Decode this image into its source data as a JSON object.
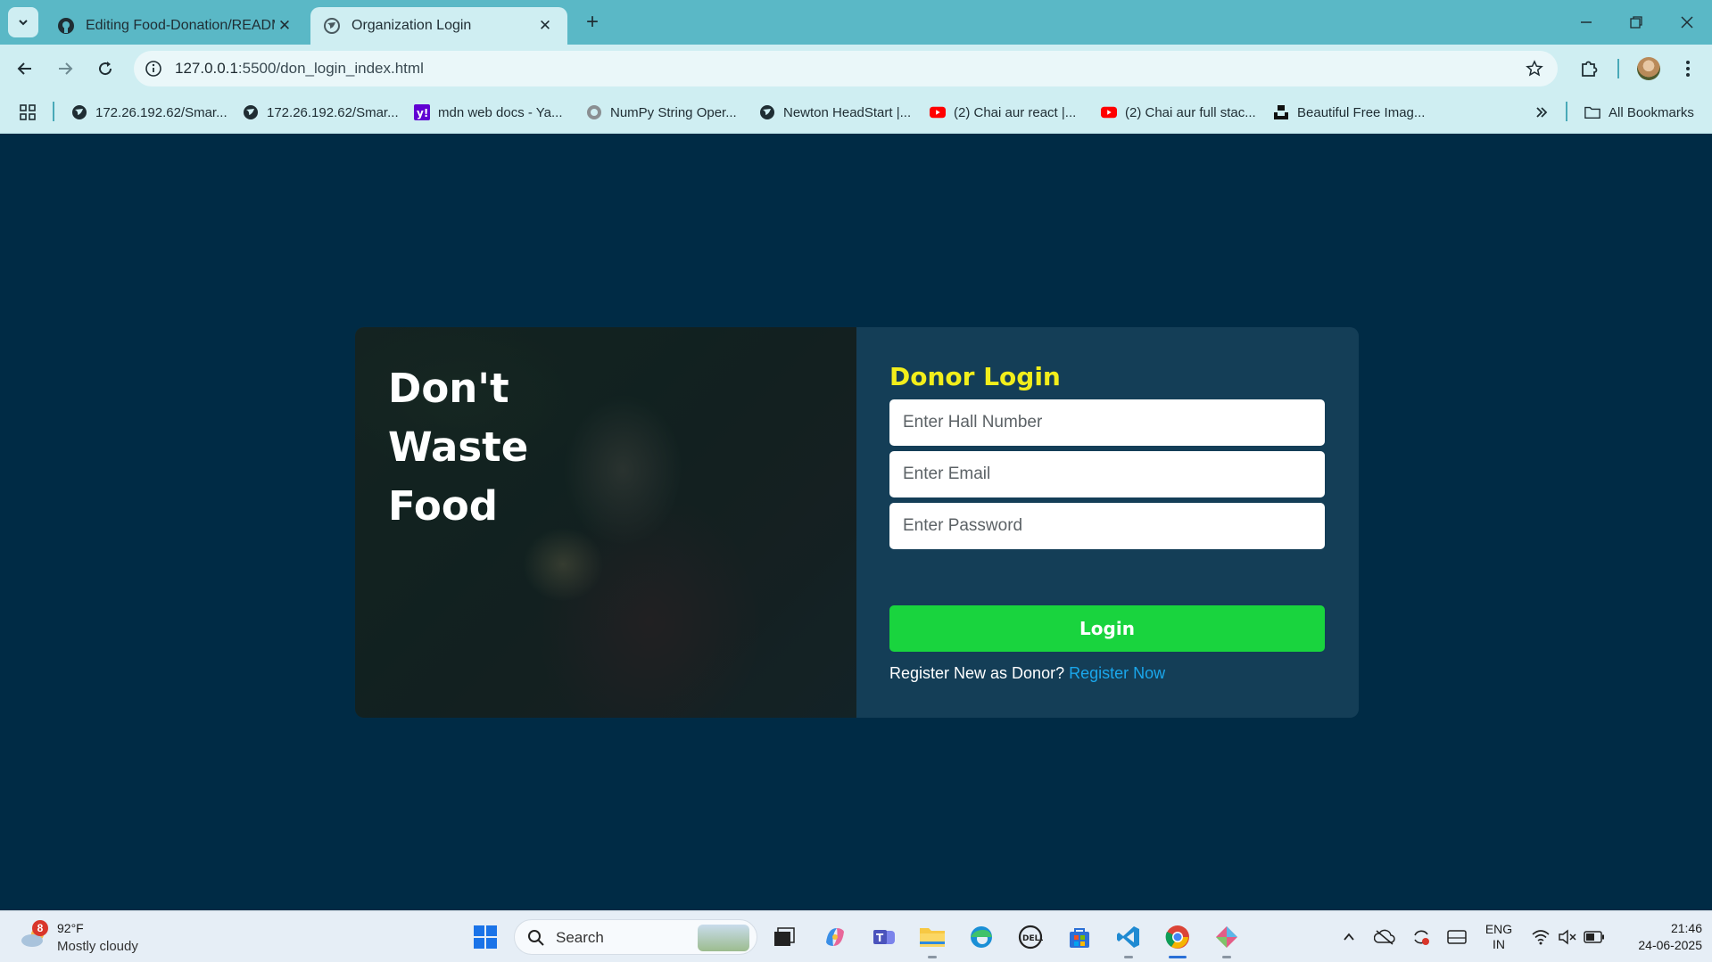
{
  "browser": {
    "tabs": [
      {
        "title": "Editing Food-Donation/README.md",
        "favicon": "github-icon",
        "active": false
      },
      {
        "title": "Organization Login",
        "favicon": "globe-icon",
        "active": true
      }
    ],
    "url_host": "127.0.0.1",
    "url_path": ":5500/don_login_index.html",
    "bookmarks": [
      {
        "label": "172.26.192.62/Smar...",
        "icon": "globe-icon"
      },
      {
        "label": "172.26.192.62/Smar...",
        "icon": "globe-icon"
      },
      {
        "label": "mdn web docs - Ya...",
        "icon": "yahoo-icon"
      },
      {
        "label": "NumPy String Oper...",
        "icon": "tf-icon"
      },
      {
        "label": "Newton HeadStart |...",
        "icon": "globe-icon"
      },
      {
        "label": "(2) Chai aur react |...",
        "icon": "youtube-icon"
      },
      {
        "label": "(2) Chai aur full stac...",
        "icon": "youtube-icon"
      },
      {
        "label": "Beautiful Free Imag...",
        "icon": "unsplash-icon"
      }
    ],
    "all_bookmarks_label": "All Bookmarks"
  },
  "page": {
    "slogan": [
      "Don't",
      "Waste",
      "Food"
    ],
    "form_title": "Donor Login",
    "fields": {
      "hall_placeholder": "Enter Hall Number",
      "email_placeholder": "Enter Email",
      "password_placeholder": "Enter Password"
    },
    "login_label": "Login",
    "register_text": "Register New as Donor?",
    "register_link": "Register Now",
    "colors": {
      "background": "#002b45",
      "card_right": "#143e57",
      "title": "#f2ee1b",
      "button": "#19d43e",
      "link": "#1aa7ec"
    }
  },
  "taskbar": {
    "weather_temp": "92°F",
    "weather_condition": "Mostly cloudy",
    "weather_badge": "8",
    "search_label": "Search",
    "lang_line1": "ENG",
    "lang_line2": "IN",
    "time": "21:46",
    "date": "24-06-2025"
  }
}
